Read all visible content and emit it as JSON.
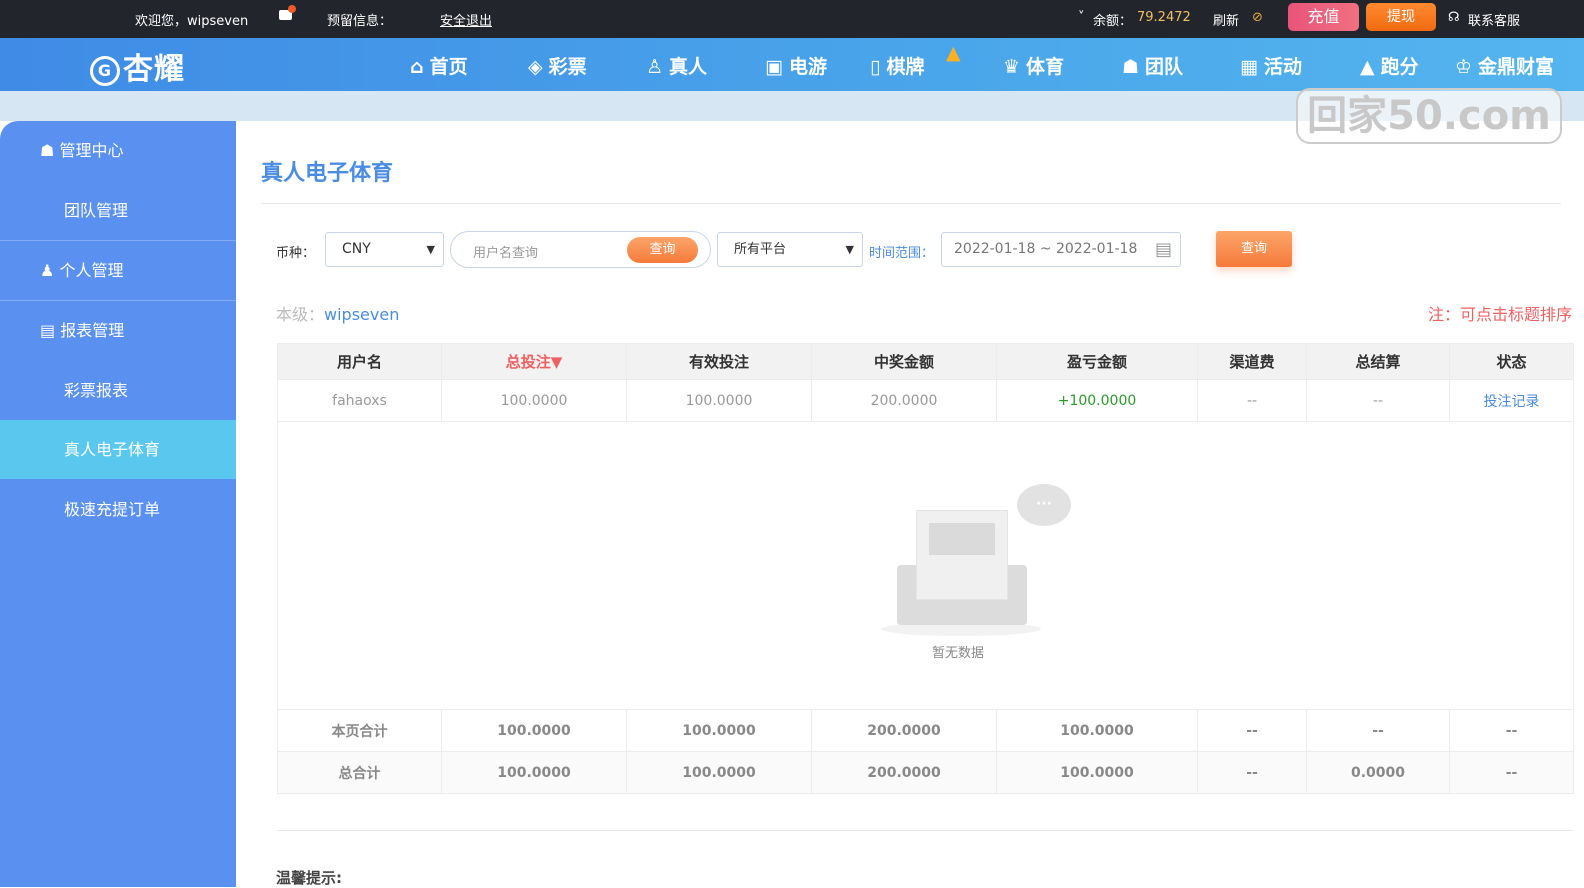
{
  "topbar": {
    "welcome": "欢迎您，wipseven",
    "reserved": "预留信息：",
    "logout": "安全退出",
    "balance_label": "余额：",
    "balance": "79.2472",
    "refresh": "刷新",
    "recharge": "充值",
    "withdraw": "提现",
    "support": "联系客服"
  },
  "nav": {
    "logo": "杏耀",
    "items": [
      {
        "icon": "⌂",
        "label": "首页"
      },
      {
        "icon": "◈",
        "label": "彩票"
      },
      {
        "icon": "♙",
        "label": "真人"
      },
      {
        "icon": "▣",
        "label": "电游"
      },
      {
        "icon": "▯",
        "label": "棋牌"
      },
      {
        "icon": "♛",
        "label": "体育"
      },
      {
        "icon": "☗",
        "label": "团队"
      },
      {
        "icon": "▦",
        "label": "活动"
      },
      {
        "icon": "▲",
        "label": "跑分"
      },
      {
        "icon": "♔",
        "label": "金鼎财富"
      }
    ]
  },
  "watermark": "回家50.com",
  "sidebar": {
    "items": [
      "管理中心",
      "团队管理",
      "个人管理",
      "报表管理",
      "彩票报表",
      "真人电子体育",
      "极速充提订单"
    ]
  },
  "main": {
    "title": "真人电子体育",
    "filters": {
      "currency_label": "币种：",
      "currency": "CNY",
      "username_placeholder": "用户名查询",
      "search_btn": "查询",
      "platform": "所有平台",
      "time_label": "时间范围：",
      "date_range": "2022-01-18 ~ 2022-01-18",
      "query_btn": "查询"
    },
    "level_label": "本级：",
    "level_user": "wipseven",
    "note": "注：可点击标题排序",
    "columns": [
      "用户名",
      "总投注▼",
      "有效投注",
      "中奖金额",
      "盈亏金额",
      "渠道费",
      "总结算",
      "状态"
    ],
    "row": [
      "fahaoxs",
      "100.0000",
      "100.0000",
      "200.0000",
      "+100.0000",
      "--",
      "--",
      "投注记录"
    ],
    "empty": "暂无数据",
    "page_total": [
      "本页合计",
      "100.0000",
      "100.0000",
      "200.0000",
      "100.0000",
      "--",
      "--",
      "--"
    ],
    "grand_total": [
      "总合计",
      "100.0000",
      "100.0000",
      "200.0000",
      "100.0000",
      "--",
      "0.0000",
      "--"
    ],
    "tips": "温馨提示:"
  },
  "colors": {
    "accent": "#4a8be4",
    "profit": "#2a9a2a",
    "sort": "#f06060"
  }
}
